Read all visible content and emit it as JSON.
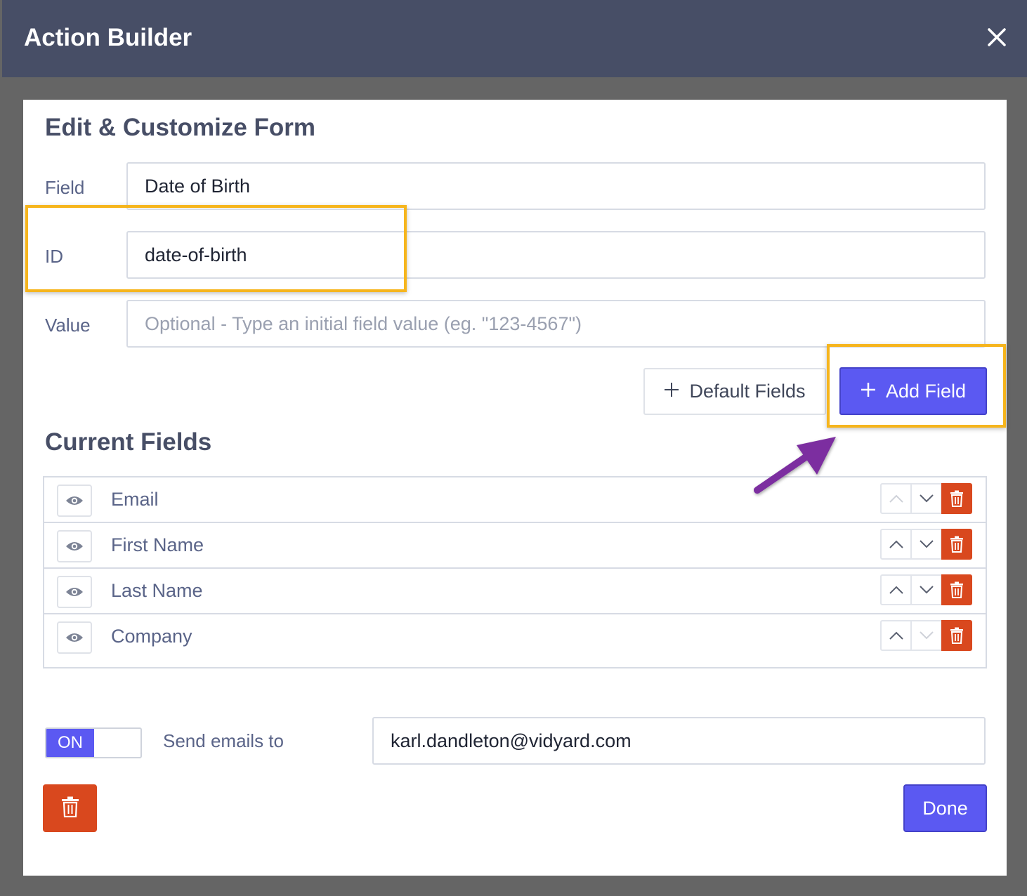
{
  "window": {
    "title": "Action Builder",
    "close_icon": "close-icon"
  },
  "form": {
    "heading": "Edit & Customize Form",
    "field": {
      "label": "Field",
      "value": "Date of Birth"
    },
    "id": {
      "label": "ID",
      "value": "date-of-birth"
    },
    "value": {
      "label": "Value",
      "placeholder": "Optional - Type an initial field value (eg. \"123-4567\")"
    },
    "default_fields_button": "Default Fields",
    "add_field_button": "Add Field"
  },
  "current_fields": {
    "heading": "Current Fields",
    "items": [
      {
        "label": "Email"
      },
      {
        "label": "First Name"
      },
      {
        "label": "Last Name"
      },
      {
        "label": "Company"
      }
    ]
  },
  "email": {
    "toggle_label": "ON",
    "toggle_state": true,
    "label": "Send emails to",
    "value": "karl.dandleton@vidyard.com"
  },
  "footer": {
    "done_button": "Done"
  },
  "colors": {
    "header_bg": "#474e66",
    "primary": "#5b59f2",
    "danger": "#d9481e",
    "highlight": "#f6b51d",
    "pointer_arrow": "#7b2fa0"
  }
}
